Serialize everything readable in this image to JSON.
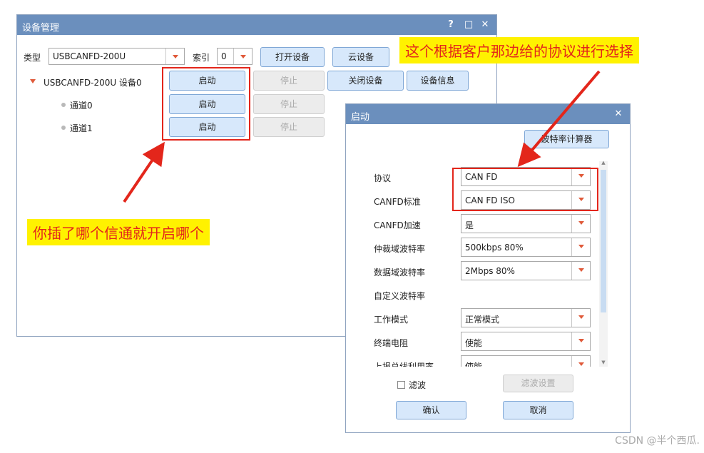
{
  "main_window": {
    "title": "设备管理",
    "help_glyph": "?",
    "maximize_glyph": "□",
    "close_glyph": "✕",
    "type_label": "类型",
    "type_value": "USBCANFD-200U",
    "index_label": "索引",
    "index_value": "0",
    "open_device": "打开设备",
    "cloud_device": "云设备",
    "close_device": "关闭设备",
    "device_info": "设备信息",
    "device_node": "USBCANFD-200U 设备0",
    "start": "启动",
    "stop": "停止",
    "channels": [
      "通道0",
      "通道1"
    ]
  },
  "dialog": {
    "title": "启动",
    "close_glyph": "✕",
    "baud_calc": "波特率计算器",
    "fields": [
      {
        "label": "协议",
        "value": "CAN FD"
      },
      {
        "label": "CANFD标准",
        "value": "CAN FD ISO"
      },
      {
        "label": "CANFD加速",
        "value": "是"
      },
      {
        "label": "仲裁域波特率",
        "value": "500kbps 80%"
      },
      {
        "label": "数据域波特率",
        "value": "2Mbps 80%"
      },
      {
        "label": "自定义波特率",
        "value": ""
      },
      {
        "label": "工作模式",
        "value": "正常模式"
      },
      {
        "label": "终端电阻",
        "value": "使能"
      },
      {
        "label": "上报总线利用率",
        "value": "使能"
      }
    ],
    "filter_label": "滤波",
    "filter_settings": "滤波设置",
    "ok": "确认",
    "cancel": "取消"
  },
  "annotations": {
    "protocol_note": "这个根据客户那边给的协议进行选择",
    "channel_note": "你插了哪个信通就开启哪个"
  },
  "watermark": "CSDN @半个西瓜.",
  "colors": {
    "titlebar": "#6b8fbd",
    "button": "#d7e8fb",
    "highlight": "#e3261b",
    "callout_bg": "#fff200"
  }
}
